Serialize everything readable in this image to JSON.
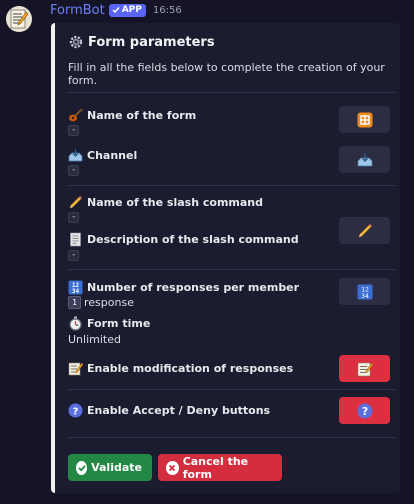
{
  "message": {
    "author": "FormBot",
    "badge": "APP",
    "timestamp": "16:56"
  },
  "embed": {
    "title": "Form parameters",
    "description": "Fill in all the fields below to complete the creation of your form.",
    "accent_color": "#f1f1f1",
    "fields": [
      {
        "label": "Name of the form",
        "value": "-",
        "icon": "guitar-icon"
      },
      {
        "label": "Channel",
        "value": "-",
        "icon": "inbox-tray-icon"
      },
      {
        "label": "Name of the slash command",
        "value": "-",
        "icon": "pencil-icon"
      },
      {
        "label": "Description of the slash command",
        "value": "-",
        "icon": "page-icon"
      },
      {
        "label": "Number of responses per member",
        "value_number": "1",
        "value": "response",
        "icon": "numbers-1234-icon"
      },
      {
        "label": "Form time",
        "value": "Unlimited",
        "icon": "stopwatch-icon"
      },
      {
        "label": "Enable modification of responses",
        "icon": "memo-icon"
      },
      {
        "label": "Enable Accept / Deny buttons",
        "icon": "question-icon"
      }
    ]
  },
  "side_buttons": [
    {
      "icon": "form-name-icon",
      "style": "secondary"
    },
    {
      "icon": "inbox-tray-icon",
      "style": "secondary"
    },
    {
      "icon": "pencil-icon",
      "style": "secondary"
    },
    {
      "icon": "numbers-1234-icon",
      "style": "secondary"
    },
    {
      "icon": "memo-icon",
      "style": "danger"
    },
    {
      "icon": "question-icon",
      "style": "danger"
    }
  ],
  "actions": {
    "validate_label": "Validate",
    "cancel_label": "Cancel the form"
  },
  "colors": {
    "background": "#141426",
    "embed": "#1c1c31",
    "secondary_button": "#2c2d42",
    "danger_button": "#dc2f3f",
    "success_button": "#238845",
    "bot_name": "#6c7ff6",
    "app_badge": "#5865f2"
  }
}
